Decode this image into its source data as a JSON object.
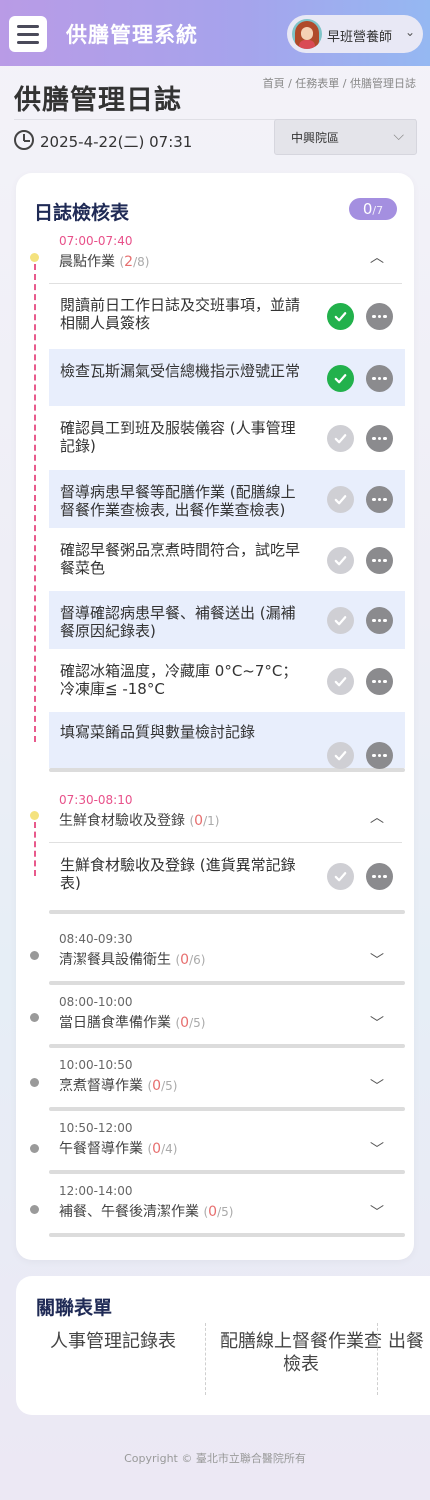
{
  "app": {
    "title": "供膳管理系統",
    "user_name": "早班營養師",
    "user_caret": "⌄"
  },
  "page": {
    "title": "供膳管理日誌",
    "breadcrumb": "首頁 / 任務表單 / 供膳管理日誌",
    "datetime": "2025-4-22(二) 07:31",
    "campus": "中興院區"
  },
  "checklist": {
    "title": "日誌檢核表",
    "done": "0",
    "total": "/7"
  },
  "sections": [
    {
      "time": "07:00-07:40",
      "name": "晨點作業",
      "done": "2",
      "total": "/8",
      "expanded": true,
      "tasks": [
        {
          "text": "閱讀前日工作日誌及交班事項，並請相關人員簽核",
          "done": true
        },
        {
          "text": "檢查瓦斯漏氣受信總機指示燈號正常",
          "done": true
        },
        {
          "text": "確認員工到班及服裝儀容 (人事管理記錄)",
          "done": false
        },
        {
          "text": "督導病患早餐等配膳作業 (配膳線上督餐作業查檢表, 出餐作業查檢表)",
          "done": false
        },
        {
          "text": "確認早餐粥品烹煮時間符合，試吃早餐菜色",
          "done": false
        },
        {
          "text": "督導確認病患早餐、補餐送出 (漏補餐原因紀錄表)",
          "done": false
        },
        {
          "text": "確認冰箱溫度，冷藏庫 0°C~7°C；冷凍庫≦ -18°C",
          "done": false
        },
        {
          "text": "填寫菜餚品質與數量檢討記錄",
          "done": false
        }
      ]
    },
    {
      "time": "07:30-08:10",
      "name": "生鮮食材驗收及登錄",
      "done": "0",
      "total": "/1",
      "expanded": true,
      "tasks": [
        {
          "text": "生鮮食材驗收及登錄 (進貨異常記錄表)",
          "done": false
        }
      ]
    },
    {
      "time": "08:40-09:30",
      "name": "清潔餐具設備衛生",
      "done": "0",
      "total": "/6",
      "expanded": false
    },
    {
      "time": "08:00-10:00",
      "name": "當日膳食準備作業",
      "done": "0",
      "total": "/5",
      "expanded": false
    },
    {
      "time": "10:00-10:50",
      "name": "烹煮督導作業",
      "done": "0",
      "total": "/5",
      "expanded": false
    },
    {
      "time": "10:50-12:00",
      "name": "午餐督導作業",
      "done": "0",
      "total": "/4",
      "expanded": false
    },
    {
      "time": "12:00-14:00",
      "name": "補餐、午餐後清潔作業",
      "done": "0",
      "total": "/5",
      "expanded": false
    }
  ],
  "related": {
    "title": "關聯表單",
    "items": [
      "人事管理記錄表",
      "配膳線上督餐作業查檢表",
      "出餐"
    ]
  },
  "footer": {
    "copyright": "Copyright © 臺北市立聯合醫院所有"
  },
  "icons": {
    "expanded": "chevron-up-icon",
    "collapsed": "chevron-down-icon",
    "check": "check-circle-icon",
    "more": "more-dots-icon"
  },
  "colors": {
    "accent": "#a48fe0",
    "done_green": "#22b14c",
    "time_pink": "#e8518a",
    "count_red": "#e76f6f"
  }
}
